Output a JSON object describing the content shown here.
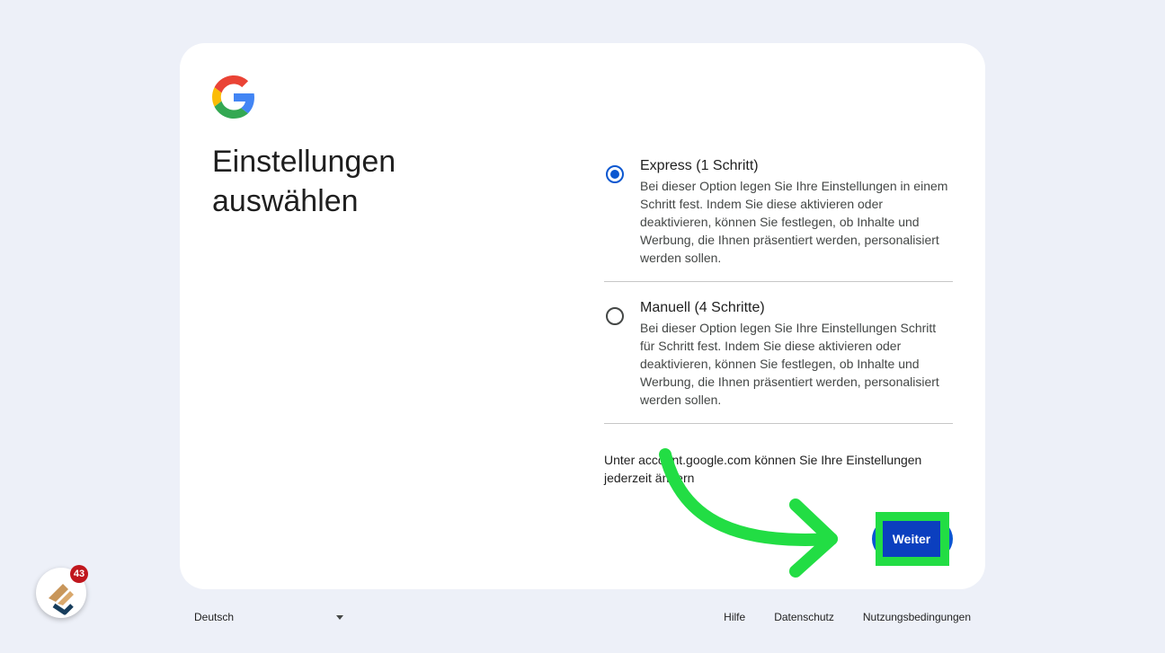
{
  "card": {
    "title": "Einstellungen auswählen",
    "options": [
      {
        "title": "Express (1 Schritt)",
        "description": "Bei dieser Option legen Sie Ihre Einstellungen in einem Schritt fest. Indem Sie diese aktivieren oder deaktivieren, können Sie festlegen, ob Inhalte und Werbung, die Ihnen präsentiert werden, personalisiert werden sollen.",
        "selected": true
      },
      {
        "title": "Manuell (4 Schritte)",
        "description": "Bei dieser Option legen Sie Ihre Einstellungen Schritt für Schritt fest. Indem Sie diese aktivieren oder deaktivieren, können Sie festlegen, ob Inhalte und Werbung, die Ihnen präsentiert werden, personalisiert werden sollen.",
        "selected": false
      }
    ],
    "note": "Unter account.google.com können Sie Ihre Einstellungen jederzeit ändern",
    "next_label": "Weiter"
  },
  "footer": {
    "language": "Deutsch",
    "links": [
      "Hilfe",
      "Datenschutz",
      "Nutzungsbedingungen"
    ]
  },
  "badge": {
    "count": "43"
  },
  "colors": {
    "accent": "#0b57d0",
    "highlight": "#22dd44",
    "background": "#edf0f8"
  }
}
